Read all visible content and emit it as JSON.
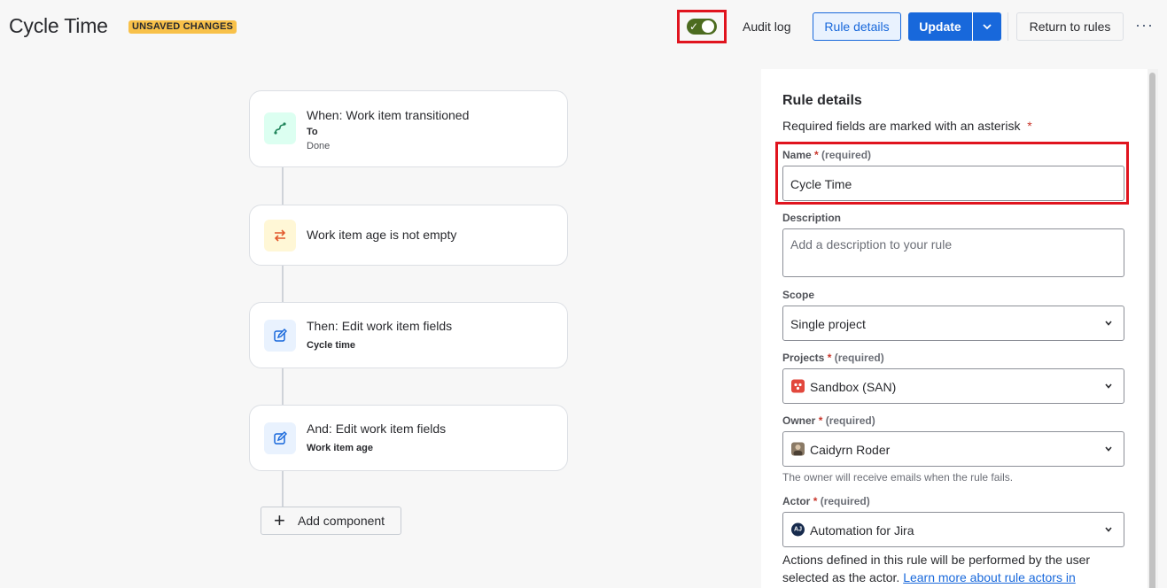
{
  "header": {
    "title": "Cycle Time",
    "badge": "UNSAVED CHANGES",
    "audit_log": "Audit log",
    "rule_details": "Rule details",
    "update": "Update",
    "return_to_rules": "Return to rules",
    "more": "···"
  },
  "toggle": {
    "enabled": true,
    "color": "#4c6b1f"
  },
  "flow": {
    "trigger": {
      "title": "When: Work item transitioned",
      "sub_label": "To",
      "sub_value": "Done",
      "icon": "transition-icon"
    },
    "condition": {
      "title": "Work item age is not empty",
      "icon": "swap-arrows-icon"
    },
    "action1": {
      "title": "Then: Edit work item fields",
      "detail": "Cycle time",
      "icon": "edit-icon"
    },
    "action2": {
      "title": "And: Edit work item fields",
      "detail": "Work item age",
      "icon": "edit-icon"
    },
    "add_component": "Add component"
  },
  "panel": {
    "title": "Rule details",
    "subtitle": "Required fields are marked with an asterisk",
    "asterisk": "*",
    "name": {
      "label": "Name",
      "required": "(required)",
      "value": "Cycle Time"
    },
    "description": {
      "label": "Description",
      "placeholder": "Add a description to your rule"
    },
    "scope": {
      "label": "Scope",
      "value": "Single project"
    },
    "projects": {
      "label": "Projects",
      "required": "(required)",
      "value": "Sandbox (SAN)"
    },
    "owner": {
      "label": "Owner",
      "required": "(required)",
      "value": "Caidyrn Roder",
      "helper": "The owner will receive emails when the rule fails."
    },
    "actor": {
      "label": "Actor",
      "required": "(required)",
      "value": "Automation for Jira",
      "avatar_text": "AJ"
    },
    "note": "Actions defined in this rule will be performed by the user selected as the actor.",
    "note_link": "Learn more about rule actors in"
  },
  "colors": {
    "primary": "#1868db",
    "badge": "#f8c14a",
    "highlight": "#e0141e"
  }
}
